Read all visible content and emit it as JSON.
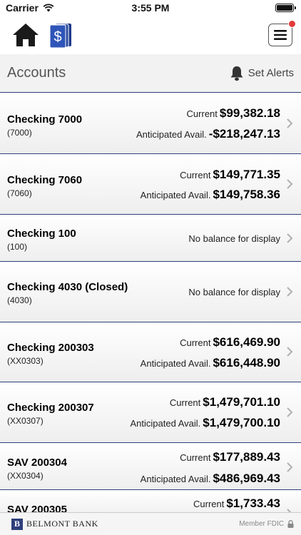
{
  "status_bar": {
    "carrier": "Carrier",
    "time": "3:55 PM"
  },
  "header": {
    "title": "Accounts",
    "set_alerts_label": "Set Alerts"
  },
  "accounts": [
    {
      "name": "Checking 7000",
      "number": "(7000)",
      "current_label": "Current",
      "current": "$99,382.18",
      "avail_label": "Anticipated Avail.",
      "avail": "-$218,247.13"
    },
    {
      "name": "Checking 7060",
      "number": "(7060)",
      "current_label": "Current",
      "current": "$149,771.35",
      "avail_label": "Anticipated Avail.",
      "avail": "$149,758.36"
    },
    {
      "name": "Checking 100",
      "number": "(100)",
      "no_balance": "No balance for display"
    },
    {
      "name": "Checking 4030 (Closed)",
      "number": "(4030)",
      "no_balance": "No balance for display"
    },
    {
      "name": "Checking 200303",
      "number": "(XX0303)",
      "current_label": "Current",
      "current": "$616,469.90",
      "avail_label": "Anticipated Avail.",
      "avail": "$616,448.90"
    },
    {
      "name": "Checking 200307",
      "number": "(XX0307)",
      "current_label": "Current",
      "current": "$1,479,701.10",
      "avail_label": "Anticipated Avail.",
      "avail": "$1,479,700.10"
    },
    {
      "name": "SAV 200304",
      "number": "(XX0304)",
      "current_label": "Current",
      "current": "$177,889.43",
      "avail_label": "Anticipated Avail.",
      "avail": "$486,969.43"
    },
    {
      "name": "SAV 200305",
      "current_label": "Current",
      "current": "$1,733.43"
    }
  ],
  "footer": {
    "logo_letter": "B",
    "bank_name": "BELMONT BANK",
    "fdic_label": "Member FDIC"
  },
  "colors": {
    "accent": "#2e3f7a",
    "notification": "#e23b3b"
  },
  "icons": {
    "home": "home-icon",
    "accounts": "dollar-cards-icon",
    "menu": "hamburger-menu-icon",
    "alerts": "bell-icon",
    "chevron": "chevron-right-icon",
    "lock": "lock-icon"
  }
}
